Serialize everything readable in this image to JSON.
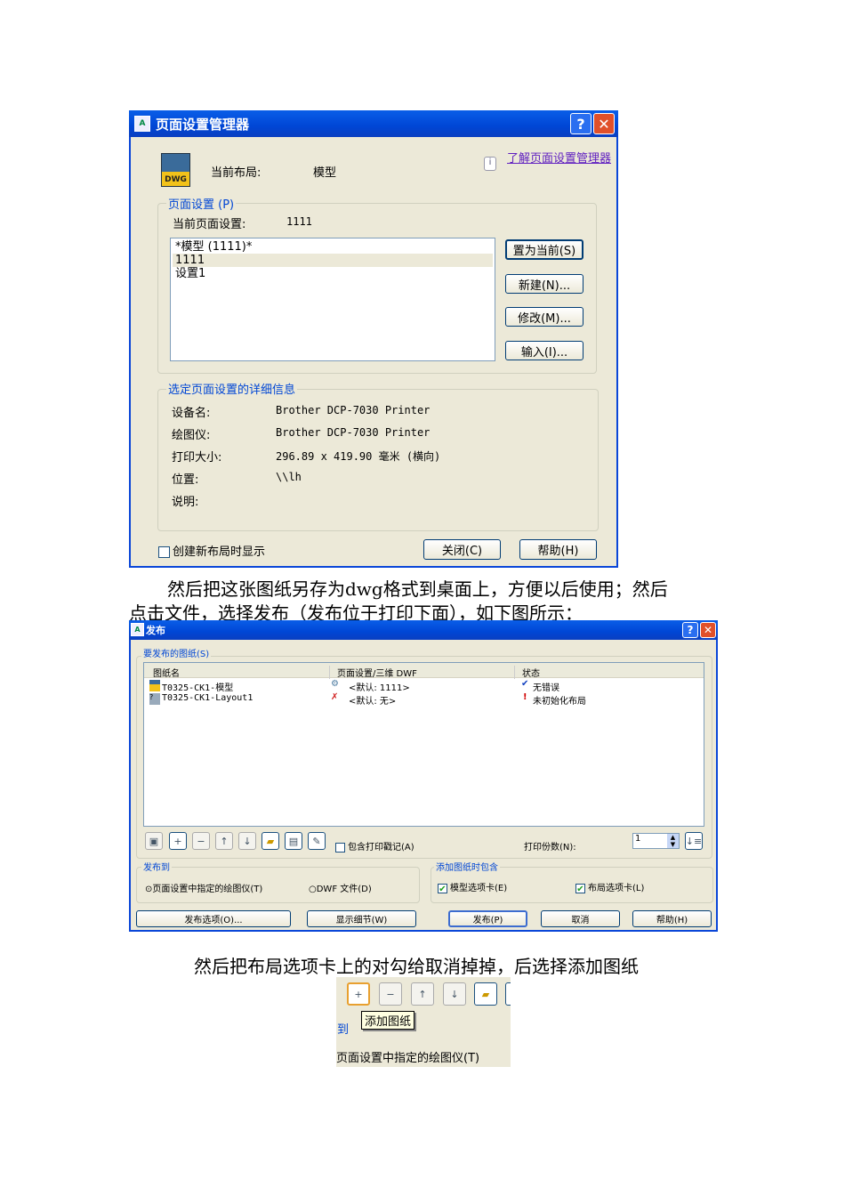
{
  "dialog1": {
    "title": "页面设置管理器",
    "current_layout_label": "当前布局:",
    "current_layout_value": "模型",
    "learn_link": "了解页面设置管理器",
    "page_setup_group": "页面设置 (P)",
    "current_setup_label": "当前页面设置:",
    "current_setup_value": "1111",
    "list": [
      "*模型 (1111)*",
      "1111",
      "设置1"
    ],
    "buttons": {
      "set_current": "置为当前(S)",
      "new": "新建(N)...",
      "modify": "修改(M)...",
      "import": "输入(I)..."
    },
    "details_group": "选定页面设置的详细信息",
    "details": [
      {
        "label": "设备名:",
        "value": "Brother DCP-7030 Printer"
      },
      {
        "label": "绘图仪:",
        "value": "Brother DCP-7030 Printer"
      },
      {
        "label": "打印大小:",
        "value": "296.89 x 419.90 毫米 (横向)"
      },
      {
        "label": "位置:",
        "value": "\\\\lh"
      },
      {
        "label": "说明:",
        "value": ""
      }
    ],
    "show_on_new_layout": "创建新布局时显示",
    "close": "关闭(C)",
    "help": "帮助(H)"
  },
  "para1_line1": "然后把这张图纸另存为dwg格式到桌面上，方便以后使用；然后",
  "para1_line2": "点击文件，选择发布（发布位于打印下面），如下图所示：",
  "dialog2": {
    "title": "发布",
    "sheets_group": "要发布的图纸(S)",
    "columns": [
      "图纸名",
      "页面设置/三维 DWF",
      "状态"
    ],
    "rows": [
      {
        "name": "T0325-CK1-模型",
        "setup": "<默认: 1111>",
        "status": "无错误",
        "status_icon": "check"
      },
      {
        "name": "T0325-CK1-Layout1",
        "setup": "<默认: 无>",
        "status": "未初始化布局",
        "status_icon": "exclamation"
      }
    ],
    "include_stamp": "包含打印戳记(A)",
    "copies_label": "打印份数(N):",
    "copies_value": "1",
    "publish_to_group": "发布到",
    "radio_plotter": "页面设置中指定的绘图仪(T)",
    "radio_dwf": "DWF 文件(D)",
    "include_group": "添加图纸时包含",
    "model_tab": "模型选项卡(E)",
    "layout_tab": "布局选项卡(L)",
    "buttons": {
      "options": "发布选项(O)...",
      "details": "显示细节(W)",
      "publish": "发布(P)",
      "cancel": "取消",
      "help": "帮助(H)"
    }
  },
  "para2": "然后把布局选项卡上的对勾给取消掉掉，后选择添加图纸",
  "crop": {
    "tooltip": "添加图纸",
    "group_fragment": "到",
    "radio_fragment": "页面设置中指定的绘图仪(T)"
  }
}
